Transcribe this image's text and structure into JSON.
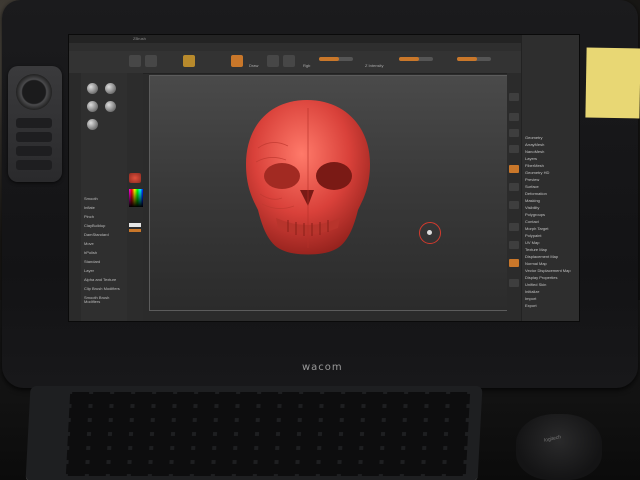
{
  "device": {
    "brand_label": "wacom"
  },
  "app": {
    "window_title": "ZBrush",
    "menu_items": [
      "Alpha",
      "Brush",
      "Color",
      "Document",
      "Draw",
      "Edit",
      "File",
      "Layer",
      "Light",
      "Macro",
      "Marker",
      "Material",
      "Movie",
      "Picker",
      "Preferences",
      "Render",
      "Stencil",
      "Stroke",
      "Texture",
      "Tool",
      "Transform",
      "Zplugin",
      "Zscript"
    ],
    "toolbar": {
      "draw_label": "Draw",
      "rgb_label": "Rgb",
      "z_intensity_label": "Z Intensity"
    },
    "left_tray_items": [
      "Smooth",
      "Inflate",
      "Pinch",
      "ClayBuildup",
      "DamStandard",
      "Move",
      "hPolish",
      "Standard",
      "Layer",
      "Alpha and Texture",
      "Clip Brush Modifiers",
      "Smooth Brush Modifiers"
    ],
    "right_tray_items": [
      "Geometry",
      "ArrayMesh",
      "NanoMesh",
      "Layers",
      "FiberMesh",
      "Geometry HD",
      "Preview",
      "Surface",
      "Deformation",
      "Masking",
      "Visibility",
      "Polygroups",
      "Contact",
      "Morph Target",
      "Polypaint",
      "UV Map",
      "Texture Map",
      "Displacement Map",
      "Normal Map",
      "Vector Displacement Map",
      "Display Properties",
      "Unified Skin",
      "Initialize",
      "Import",
      "Export"
    ],
    "colors": {
      "accent_orange": "#c9772a",
      "skull_red": "#d9413a",
      "cursor_ring": "#d33a2d"
    }
  },
  "peripherals": {
    "mouse_label": "logitech"
  }
}
